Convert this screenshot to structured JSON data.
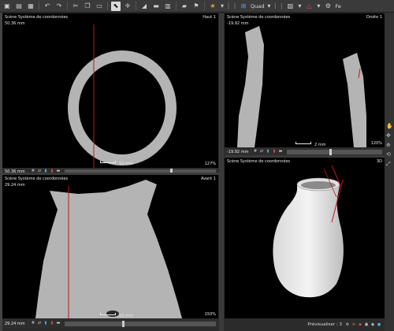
{
  "toolbar": {
    "layout_label": "Quad",
    "overflow_label": "Fe",
    "icons": [
      "save-icon",
      "save-all-icon",
      "export-icon",
      "undo-icon",
      "redo-icon",
      "cut-icon",
      "copy-icon",
      "paste-icon",
      "select-arrow-icon",
      "move-icon",
      "measure-icon",
      "ruler-icon",
      "tag-icon",
      "flag-icon",
      "star-icon",
      "layout-quad-icon",
      "warning-icon",
      "settings-icon"
    ]
  },
  "viewports": {
    "top": {
      "title": "Scène Système de coordonnées",
      "coord": "50.36 mm",
      "name": "Haut 1",
      "zoom": "127%",
      "scale": "10 mm",
      "bar_value": "50.36 mm"
    },
    "right": {
      "title": "Scène Système de coordonnées",
      "coord": "-19.92 mm",
      "name": "Droite 1",
      "zoom": "120%",
      "scale": "2 mm",
      "bar_value": "-19.92 mm"
    },
    "front": {
      "title": "Scène Système de coordonnées",
      "coord": "29.24 mm",
      "name": "Avant 1",
      "zoom": "150%",
      "scale": "10 mm",
      "bar_value": "29.24 mm"
    },
    "three_d": {
      "title": "Scène Système de coordonnées",
      "name": "3D",
      "preview_label": "Prévisualiser : 3"
    }
  },
  "colors": {
    "slice_line": "#c0161b",
    "object_gray": "#b4b4b4",
    "background": "#000000",
    "panel": "#2e2e2e"
  }
}
